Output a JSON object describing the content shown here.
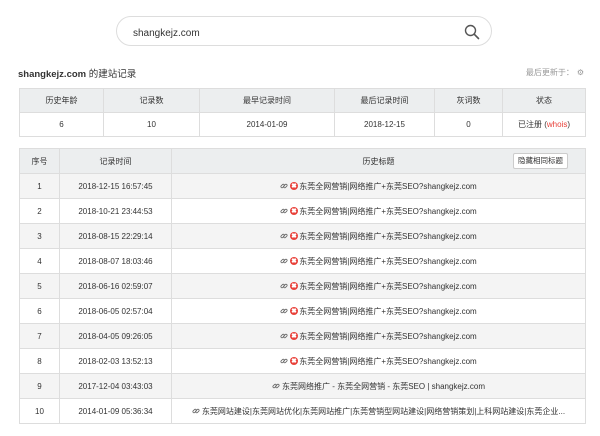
{
  "search": {
    "value": "shangkejz.com",
    "placeholder": ""
  },
  "heading": {
    "domain": "shangkejz.com",
    "suffix": " 的建站记录"
  },
  "refresh_label": "最后更新于：",
  "summary": {
    "headers": [
      "历史年龄",
      "记录数",
      "最早记录时间",
      "最后记录时间",
      "灰词数",
      "状态"
    ],
    "values": [
      "6",
      "10",
      "2014-01-09",
      "2018-12-15",
      "0"
    ],
    "status": "已注册",
    "whois_link": "whois",
    "paren_open": "(",
    "paren_close": ")"
  },
  "history": {
    "headers": [
      "序号",
      "记录时间",
      "历史标题"
    ],
    "hide_button": "隐藏相同标题",
    "rows": [
      {
        "index": "1",
        "time": "2018-12-15 16:57:45",
        "title": "东莞全网营销|网络推广+东莞SEO?shangkejz.com",
        "flag": true
      },
      {
        "index": "2",
        "time": "2018-10-21 23:44:53",
        "title": "东莞全网营销|网络推广+东莞SEO?shangkejz.com",
        "flag": true
      },
      {
        "index": "3",
        "time": "2018-08-15 22:29:14",
        "title": "东莞全网营销|网络推广+东莞SEO?shangkejz.com",
        "flag": true
      },
      {
        "index": "4",
        "time": "2018-08-07 18:03:46",
        "title": "东莞全网营销|网络推广+东莞SEO?shangkejz.com",
        "flag": true
      },
      {
        "index": "5",
        "time": "2018-06-16 02:59:07",
        "title": "东莞全网营销|网络推广+东莞SEO?shangkejz.com",
        "flag": true
      },
      {
        "index": "6",
        "time": "2018-06-05 02:57:04",
        "title": "东莞全网营销|网络推广+东莞SEO?shangkejz.com",
        "flag": true
      },
      {
        "index": "7",
        "time": "2018-04-05 09:26:05",
        "title": "东莞全网营销|网络推广+东莞SEO?shangkejz.com",
        "flag": true
      },
      {
        "index": "8",
        "time": "2018-02-03 13:52:13",
        "title": "东莞全网营销|网络推广+东莞SEO?shangkejz.com",
        "flag": true
      },
      {
        "index": "9",
        "time": "2017-12-04 03:43:03",
        "title": "东莞网络推广 - 东莞全网营销 - 东莞SEO | shangkejz.com",
        "flag": false
      },
      {
        "index": "10",
        "time": "2014-01-09 05:36:34",
        "title": "东莞网站建设|东莞网站优化|东莞网站推广|东莞营销型网站建设|网络营销策划|上科网站建设|东莞企业...",
        "flag": false
      }
    ]
  },
  "colors": {
    "accent": "#e8413a",
    "header_bg": "#eceeef",
    "row_alt": "#f4f4f4",
    "border": "#dddddd"
  },
  "icons": {
    "search": "search-icon",
    "refresh": "gear-icon",
    "link": "link-icon",
    "flag": "warning-badge-icon"
  }
}
